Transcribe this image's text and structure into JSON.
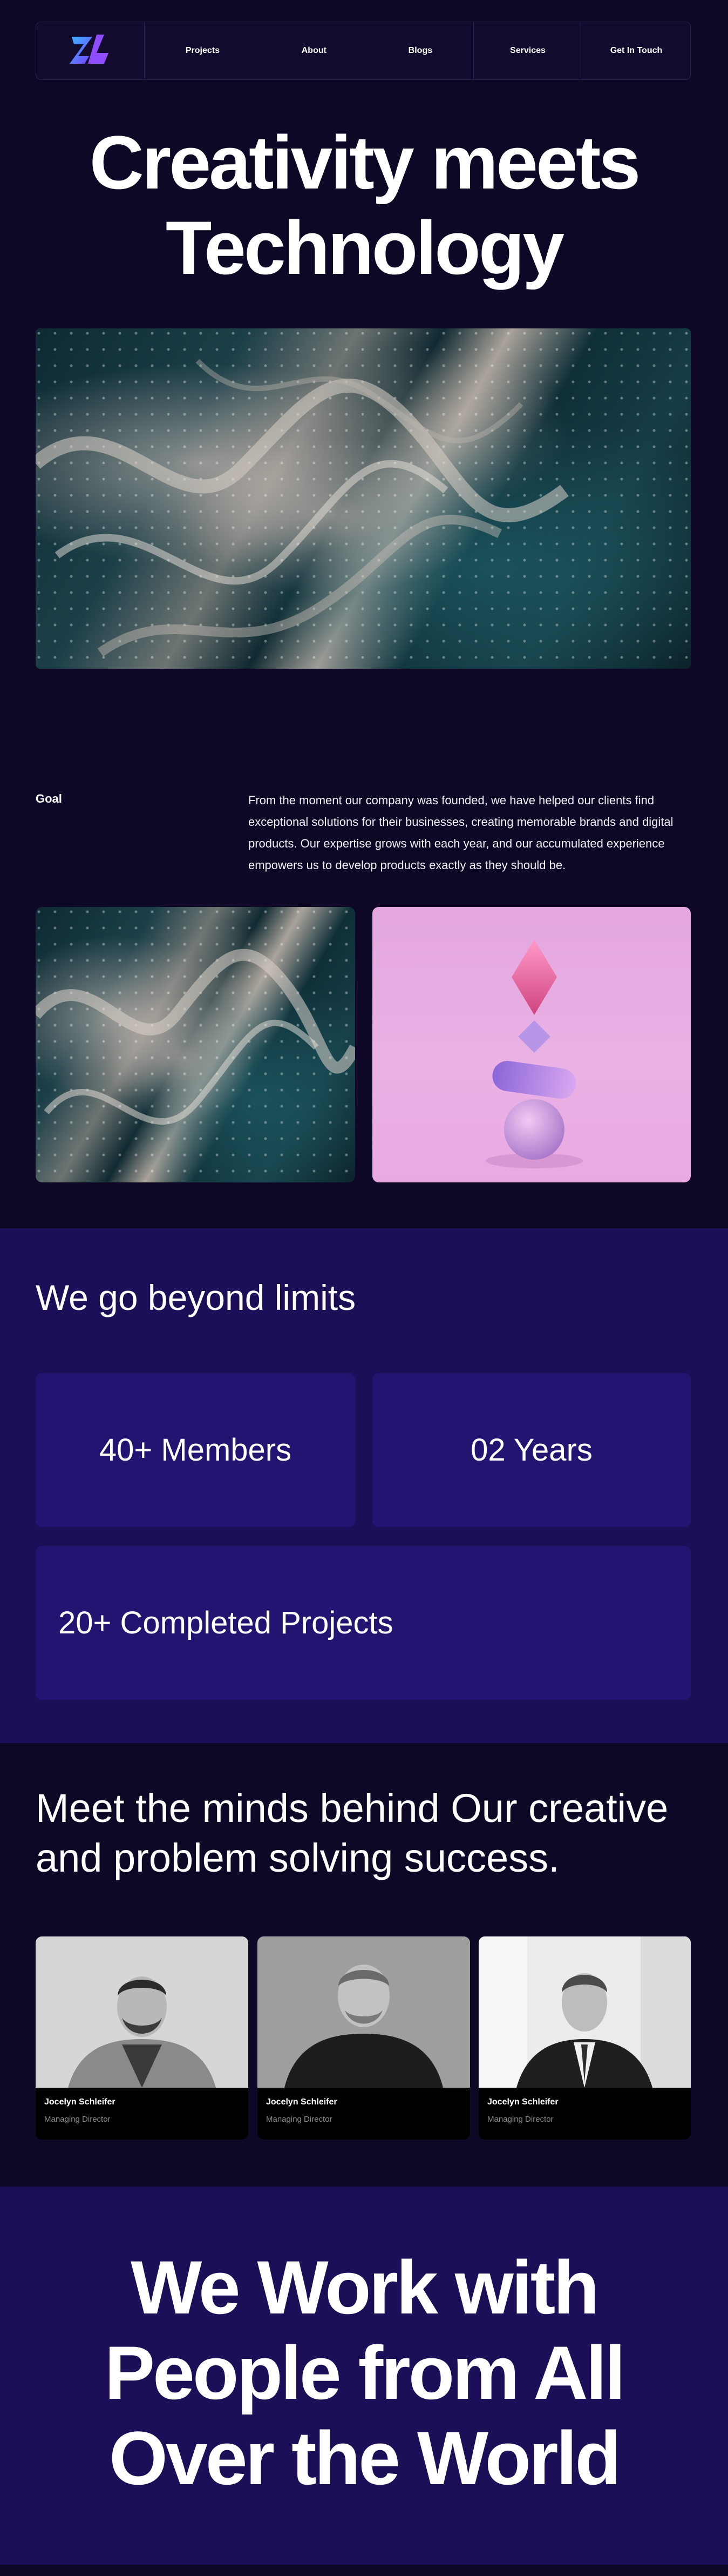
{
  "nav": {
    "logo_alt": "ZL logo",
    "links": [
      "Projects",
      "About",
      "Blogs"
    ],
    "services": "Services",
    "cta": "Get In Touch"
  },
  "hero": {
    "title_line1": "Creativity meets",
    "title_line2": "Technology",
    "image": "abstract-marble-texture"
  },
  "goal": {
    "label": "Goal",
    "text": "From the moment our company was founded, we have helped our clients find exceptional solutions for their businesses, creating memorable brands and digital products. Our expertise grows with each year, and our accumulated experience empowers us to develop products exactly as they should be.",
    "image_left": "abstract-marble-texture",
    "image_right": "stacked-3d-shapes"
  },
  "stats": {
    "title": "We go beyond limits",
    "members": "40+ Members",
    "years": "02 Years",
    "projects": "20+ Completed Projects"
  },
  "team": {
    "title": "Meet the minds behind Our creative and problem solving success.",
    "members": [
      {
        "name": "Jocelyn Schleifer",
        "role": "Managing Director"
      },
      {
        "name": "Jocelyn Schleifer",
        "role": "Managing Director"
      },
      {
        "name": "Jocelyn Schleifer",
        "role": "Managing Director"
      }
    ]
  },
  "world": {
    "line1": "We Work with",
    "line2": "People from All",
    "line3": "Over the World"
  },
  "colors": {
    "background": "#0e0826",
    "band": "#1c0f58",
    "card": "#241472",
    "logo_gradient_start": "#3ab7ff",
    "logo_gradient_end": "#7a3cff"
  }
}
